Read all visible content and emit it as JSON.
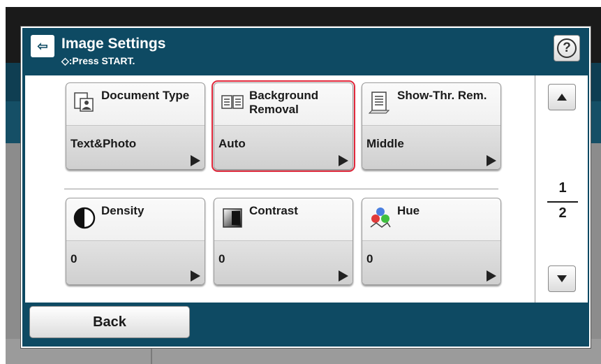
{
  "header": {
    "title": "Image Settings",
    "subtitle": "◇:Press START.",
    "help_icon": "question-mark-icon",
    "help_label": "?"
  },
  "tiles": [
    {
      "label": "Document Type",
      "value": "Text&Photo",
      "icon": "document-photo-icon",
      "selected": false
    },
    {
      "label": "Background Removal",
      "value": "Auto",
      "icon": "background-removal-icon",
      "selected": true
    },
    {
      "label": "Show-Thr. Rem.",
      "value": "Middle",
      "icon": "show-through-icon",
      "selected": false
    },
    {
      "label": "Density",
      "value": "0",
      "icon": "density-icon",
      "selected": false
    },
    {
      "label": "Contrast",
      "value": "0",
      "icon": "contrast-icon",
      "selected": false
    },
    {
      "label": "Hue",
      "value": "0",
      "icon": "hue-icon",
      "selected": false
    }
  ],
  "pager": {
    "current": "1",
    "total": "2"
  },
  "footer": {
    "back_label": "Back"
  },
  "colors": {
    "accent_selected": "#e0283b",
    "dialog_bg": "#0e4a63"
  }
}
